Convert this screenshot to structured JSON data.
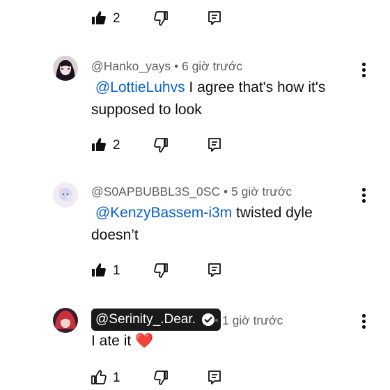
{
  "comments": [
    {
      "handle": "@Hanko_yays",
      "time": "6 giờ trước",
      "mention": "@LottieLuhvs",
      "body": " I agree that's how it's supposed to look",
      "likes": "2"
    },
    {
      "handle": "@S0APBUBBL3S_0SC",
      "time": "5 giờ trước",
      "mention": "@KenzyBassem-i3m",
      "body": " twisted dyle doesn’t",
      "likes": "1"
    },
    {
      "handle": "@Serinity_.Dear.",
      "time": "1 giờ trước",
      "body": "I ate it ❤️",
      "likes": "1"
    }
  ],
  "top_row": {
    "likes": "2"
  },
  "separator": "•",
  "icons": [
    "like-icon",
    "dislike-icon",
    "reply-icon",
    "more-options-icon",
    "verified-check-icon"
  ]
}
